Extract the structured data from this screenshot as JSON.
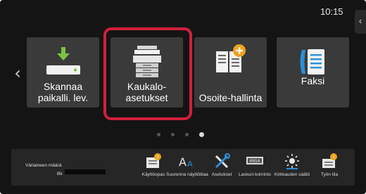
{
  "status": {
    "time": "10:15"
  },
  "nav": {
    "left_arrow": "‹",
    "collapse": "‹"
  },
  "tiles": [
    {
      "label": "Skannaa paikalli. lev.",
      "icon": "scan-to-local-drive-icon"
    },
    {
      "label": "Kaukalo-asetukset",
      "icon": "tray-settings-printer-icon",
      "selected": true
    },
    {
      "label": "Osoite-hallinta",
      "icon": "address-book-icon"
    },
    {
      "label": "Faksi",
      "icon": "fax-icon"
    }
  ],
  "pager": {
    "pages": 4,
    "active_index": 3
  },
  "toner": {
    "label": "Väriaineen määrä",
    "color": "Bk"
  },
  "shortcuts": [
    {
      "label": "Käyttöopas",
      "icon": "manual-icon"
    },
    {
      "label": "Suurenna näyttötilaa",
      "icon": "enlarge-display-icon"
    },
    {
      "label": "Asetukset",
      "icon": "settings-tools-icon"
    },
    {
      "label": "Laskuri-toiminto",
      "icon": "counter-icon"
    },
    {
      "label": "Kirkkauden säätö",
      "icon": "brightness-icon"
    },
    {
      "label": "Työn tila",
      "icon": "job-status-icon"
    }
  ],
  "colors": {
    "highlight": "#d21f3c",
    "accent_orange": "#f0a11f",
    "accent_green": "#7cc242",
    "accent_blue": "#2a8fd6"
  }
}
